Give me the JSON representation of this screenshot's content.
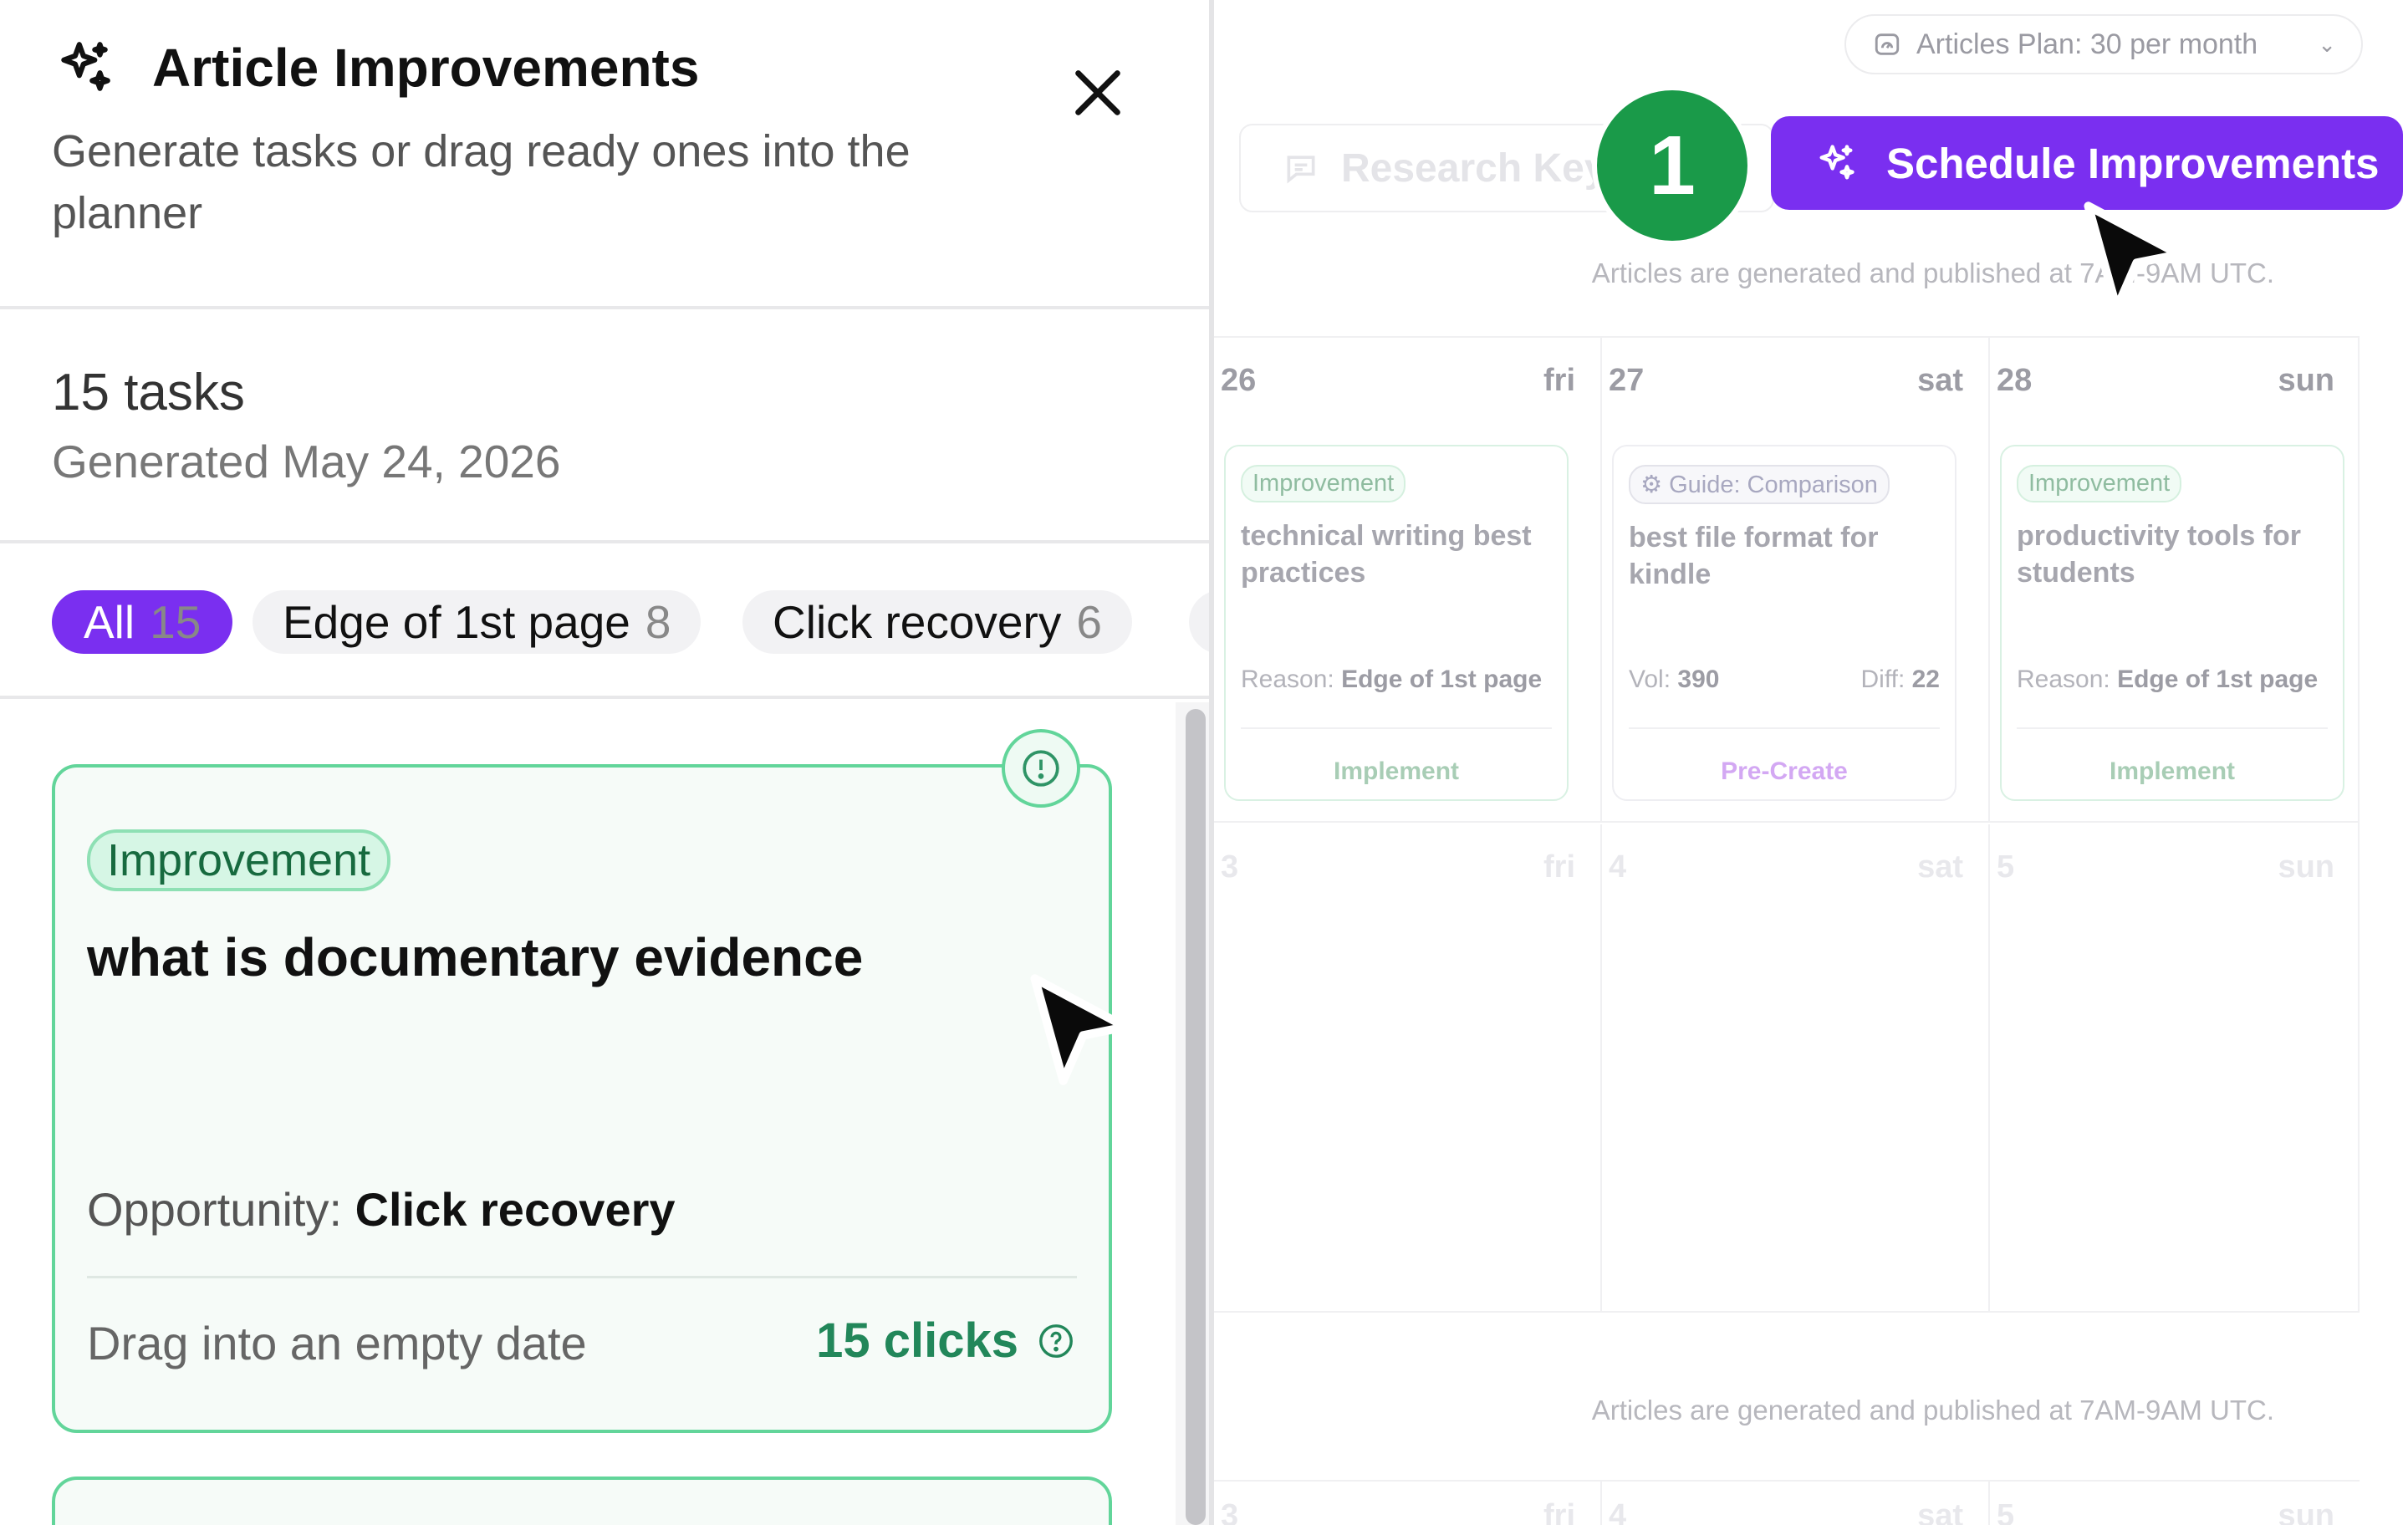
{
  "panel": {
    "title": "Article Improvements",
    "subtitle": "Generate tasks or drag ready ones into the planner",
    "tasks_count": "15 tasks",
    "generated": "Generated May 24, 2026",
    "filters": [
      {
        "label": "All",
        "count": "15"
      },
      {
        "label": "Edge of 1st page",
        "count": "8"
      },
      {
        "label": "Click recovery",
        "count": "6"
      }
    ],
    "task": {
      "tag": "Improvement",
      "title": "what is documentary evidence",
      "opportunity_label": "Opportunity:",
      "opportunity_value": "Click recovery",
      "drag_hint": "Drag into an empty date",
      "clicks": "15 clicks"
    }
  },
  "header": {
    "plan": "Articles Plan: 30 per month",
    "research_label": "Research Key",
    "schedule_label": "Schedule Improvements",
    "step_number": "1",
    "publish_note_top": "Articles are generated and published at 7AM-9AM UTC.",
    "publish_note_bottom": "Articles are generated and published at 7AM-9AM UTC."
  },
  "calendar": {
    "row1": [
      {
        "day": "26",
        "dow": "fri",
        "tag": "Improvement",
        "title": "technical writing best practices",
        "meta_left_label": "Reason:",
        "meta_left_value": "Edge of 1st page",
        "meta_right_label": "",
        "meta_right_value": "",
        "action": "Implement"
      },
      {
        "day": "27",
        "dow": "sat",
        "tag": "Guide: Comparison",
        "title": "best file format for kindle",
        "meta_left_label": "Vol:",
        "meta_left_value": "390",
        "meta_right_label": "Diff:",
        "meta_right_value": "22",
        "action": "Pre-Create"
      },
      {
        "day": "28",
        "dow": "sun",
        "tag": "Improvement",
        "title": "productivity tools for students",
        "meta_left_label": "Reason:",
        "meta_left_value": "Edge of 1st page",
        "meta_right_label": "",
        "meta_right_value": "",
        "action": "Implement"
      }
    ],
    "row2": [
      {
        "day": "3",
        "dow": "fri"
      },
      {
        "day": "4",
        "dow": "sat"
      },
      {
        "day": "5",
        "dow": "sun"
      }
    ],
    "row3": [
      {
        "day": "3",
        "dow": "fri"
      },
      {
        "day": "4",
        "dow": "sat"
      },
      {
        "day": "5",
        "dow": "sun"
      }
    ]
  },
  "colors": {
    "accent": "#7a2ff0",
    "success": "#1a9a49",
    "task_border": "#62d59a"
  },
  "icons": [
    "sparkle-icon",
    "close-icon",
    "info-icon",
    "help-icon",
    "gauge-icon",
    "chevron-down-icon",
    "chat-icon",
    "cursor-icon"
  ]
}
